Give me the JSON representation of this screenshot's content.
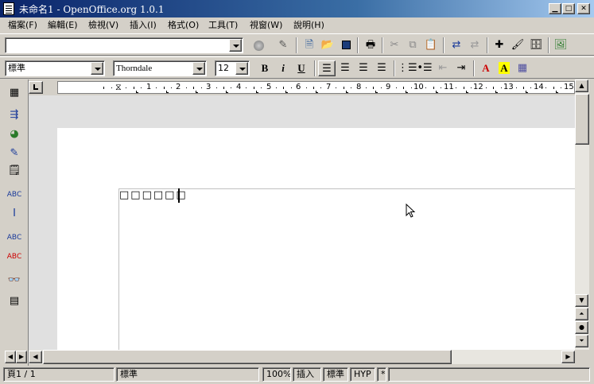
{
  "window": {
    "title": "未命名1 - OpenOffice.org 1.0.1",
    "controls": [
      "minimize-button",
      "maximize-button",
      "close-button"
    ]
  },
  "menu": [
    {
      "label": "檔案(F)"
    },
    {
      "label": "編輯(E)"
    },
    {
      "label": "檢視(V)"
    },
    {
      "label": "插入(I)"
    },
    {
      "label": "格式(O)"
    },
    {
      "label": "工具(T)"
    },
    {
      "label": "視窗(W)"
    },
    {
      "label": "說明(H)"
    }
  ],
  "function_bar": {
    "url_value": "",
    "icons": [
      "load-url-icon",
      "edit-file-icon",
      "new-document-icon",
      "open-icon",
      "save-icon",
      "print-icon",
      "cut-icon",
      "copy-icon",
      "paste-icon",
      "undo-icon",
      "redo-icon",
      "navigator-icon",
      "stylist-icon",
      "data-sources-icon",
      "gallery-icon"
    ]
  },
  "object_bar": {
    "paragraph_style": "標準",
    "font_name": "Thorndale",
    "font_size": "12",
    "bold_label": "B",
    "italic_label": "i",
    "underline_label": "U",
    "font_color_label": "A",
    "highlight_label": "A"
  },
  "ruler": {
    "numbers": [
      "1",
      "2",
      "3",
      "4",
      "5",
      "6",
      "7",
      "8",
      "9",
      "10",
      "11",
      "12",
      "13",
      "14",
      "15"
    ]
  },
  "document": {
    "text": "□□□□□□"
  },
  "status": {
    "page": "頁1 / 1",
    "style": "標準",
    "zoom": "100%",
    "insert_mode": "插入",
    "selection_mode": "標準",
    "hyphenation": "HYP",
    "modified": "*"
  },
  "colors": {
    "title_gradient_start": "#0a246a",
    "title_gradient_end": "#a6caf0",
    "face": "#d4d0c8",
    "font_color_icon": "#cc0000",
    "highlight_icon": "#ffff00"
  }
}
